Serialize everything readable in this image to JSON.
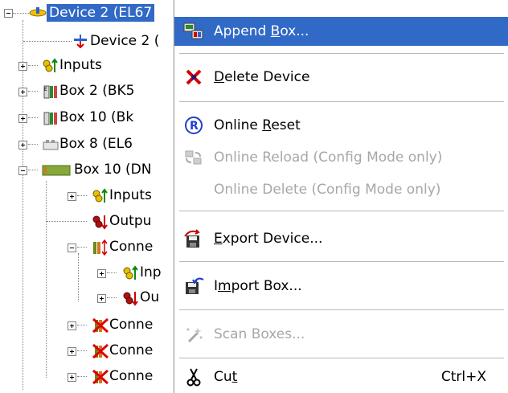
{
  "tree": {
    "items": [
      {
        "label": "Device 2 (EL67",
        "selected": true
      },
      {
        "label": "Device 2 ("
      },
      {
        "label": "Inputs"
      },
      {
        "label": "Box 2 (BK5"
      },
      {
        "label": "Box 10 (Bk"
      },
      {
        "label": "Box 8 (EL6"
      },
      {
        "label": "Box 10 (DN"
      },
      {
        "label": "Inputs"
      },
      {
        "label": "Outpu"
      },
      {
        "label": "Conne"
      },
      {
        "label": "Inp"
      },
      {
        "label": "Ou"
      },
      {
        "label": "Conne"
      },
      {
        "label": "Conne"
      },
      {
        "label": "Conne"
      }
    ]
  },
  "menu": {
    "append_box": {
      "pre": "Append ",
      "acc": "B",
      "post": "ox..."
    },
    "delete_device": {
      "pre": "",
      "acc": "D",
      "post": "elete Device"
    },
    "online_reset": {
      "pre": "Online ",
      "acc": "R",
      "post": "eset"
    },
    "online_reload": "Online Reload (Config Mode only)",
    "online_delete": "Online Delete (Config Mode only)",
    "export_device": {
      "pre": "",
      "acc": "E",
      "post": "xport Device..."
    },
    "import_box": {
      "pre": "I",
      "acc": "m",
      "post": "port Box..."
    },
    "scan_boxes": "Scan Boxes...",
    "cut": {
      "pre": "Cu",
      "acc": "t",
      "post": "",
      "shortcut": "Ctrl+X"
    }
  },
  "colors": {
    "highlight": "#3169c6",
    "disabled_text": "#a7a7a7"
  }
}
